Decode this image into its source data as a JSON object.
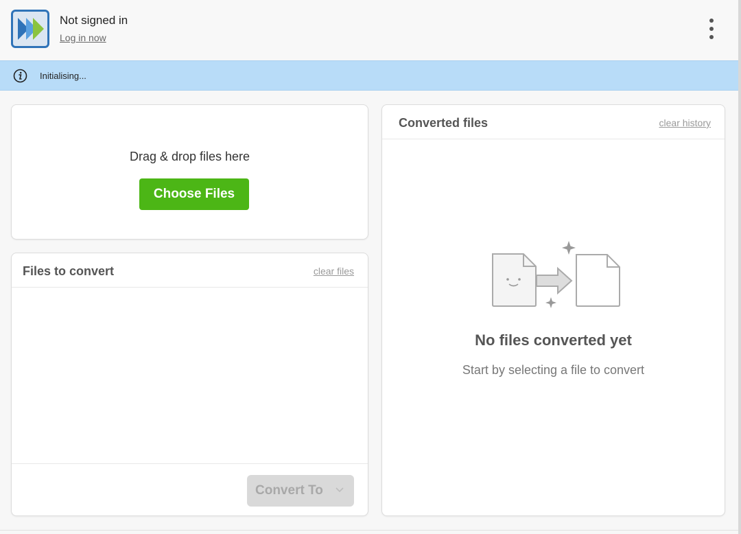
{
  "header": {
    "user_status": "Not signed in",
    "login_link": "Log in now",
    "menu_icon": "kebab-menu-icon",
    "logo_icon": "double-chevron-logo"
  },
  "infobar": {
    "icon": "info-icon",
    "message": "Initialising..."
  },
  "dropzone": {
    "prompt": "Drag & drop files here",
    "choose_label": "Choose Files"
  },
  "files_to_convert": {
    "title": "Files to convert",
    "clear_label": "clear files",
    "convert_label": "Convert To",
    "convert_icon": "chevron-down-icon"
  },
  "converted_files": {
    "title": "Converted files",
    "clear_label": "clear history",
    "empty_title": "No files converted yet",
    "empty_subtitle": "Start by selecting a file to convert",
    "illustration": "file-conversion-illustration"
  },
  "colors": {
    "accent_green": "#4cb616",
    "info_bar": "#b8dcf8",
    "disabled_button": "#d9d9d9",
    "logo_blue": "#2f73b8",
    "logo_green": "#8bc43f"
  }
}
